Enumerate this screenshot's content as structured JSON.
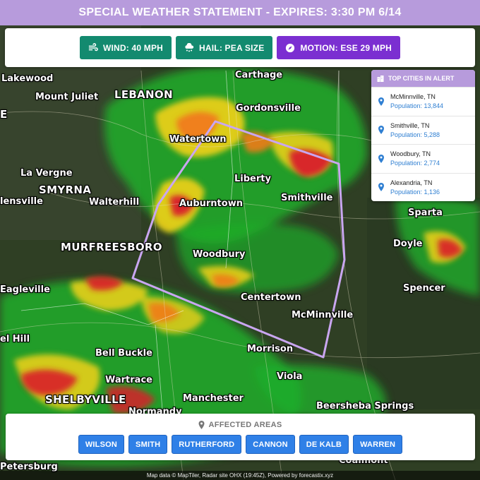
{
  "header": {
    "title": "SPECIAL WEATHER STATEMENT - EXPIRES: 3:30 PM 6/14"
  },
  "badges": {
    "wind": "WIND: 40 MPH",
    "hail": "HAIL: PEA SIZE",
    "motion": "MOTION: ESE 29 MPH"
  },
  "cities_panel": {
    "title": "TOP CITIES IN ALERT",
    "items": [
      {
        "name": "McMinnville, TN",
        "population": "Population: 13,844"
      },
      {
        "name": "Smithville, TN",
        "population": "Population: 5,288"
      },
      {
        "name": "Woodbury, TN",
        "population": "Population: 2,774"
      },
      {
        "name": "Alexandria, TN",
        "population": "Population: 1,136"
      }
    ]
  },
  "areas_panel": {
    "title": "AFFECTED AREAS",
    "areas": [
      "WILSON",
      "SMITH",
      "RUTHERFORD",
      "CANNON",
      "DE KALB",
      "WARREN"
    ]
  },
  "map": {
    "places": [
      "Lakewood",
      "Mount Juliet",
      "LEBANON",
      "Carthage",
      "Gordonsville",
      "Watertown",
      "La Vergne",
      "SMYRNA",
      "Liberty",
      "Smithville",
      "Walterhill",
      "Auburntown",
      "Sparta",
      "MURFREESBORO",
      "Woodbury",
      "Doyle",
      "Eagleville",
      "Spencer",
      "Centertown",
      "McMinnville",
      "Bell Buckle",
      "Morrison",
      "Wartrace",
      "Viola",
      "SHELBYVILLE",
      "Manchester",
      "Normandy",
      "Beersheba Springs",
      "Petersburg",
      "Coalmont",
      "E",
      "lensville",
      "el Hill"
    ],
    "colors": {
      "terrain": "#2f3f24",
      "radar_green": "#1fae2a",
      "radar_yellow": "#f2d21b",
      "radar_orange": "#f07b1a",
      "radar_red": "#d8202a",
      "polygon": "#c9a6f0"
    }
  },
  "footer": {
    "credit": "Map data © MapTiler, Radar site OHX (19:45Z), Powered by forecastix.xyz"
  }
}
